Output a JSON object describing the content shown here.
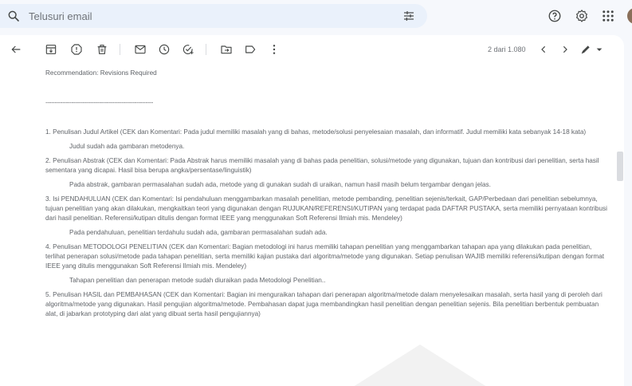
{
  "search": {
    "placeholder": "Telusuri email"
  },
  "toolbar": {
    "page_count": "2 dari 1.080"
  },
  "email": {
    "recommendation": "Recommendation: Revisions Required",
    "divider": "----------------------------------------------------------",
    "items": [
      {
        "text": "1. Penulisan Judul Artikel (CEK dan Komentari: Pada judul memiliki masalah yang di bahas, metode/solusi penyelesaian masalah, dan informatif. Judul memiliki kata sebanyak 14-18 kata)",
        "reply": "Judul sudah ada gambaran metodenya."
      },
      {
        "text": "2. Penulisan Abstrak (CEK dan Komentari: Pada Abstrak harus memiliki masalah yang di bahas pada penelitian, solusi/metode yang digunakan, tujuan dan kontribusi dari penelitian, serta hasil sementara yang dicapai. Hasil bisa berupa angka/persentase/linguistik)",
        "reply": "Pada abstrak, gambaran permasalahan sudah ada, metode yang di gunakan sudah di uraikan, namun hasil masih belum tergambar dengan jelas."
      },
      {
        "text": "3. Isi PENDAHULUAN (CEK dan Komentari: Isi pendahuluan menggambarkan masalah penelitian, metode pembanding, penelitian sejenis/terkait, GAP/Perbedaan dari penelitian sebelumnya, tujuan penelitian yang akan dilakukan, mengkaitkan teori yang digunakan dengan RUJUKAN/REFERENSI/KUTIPAN yang terdapat pada DAFTAR PUSTAKA, serta memiliki pernyataan kontribusi dari hasil penelitian. Referensi/kutipan ditulis dengan format IEEE yang menggunakan Soft Referensi Ilmiah mis. Mendeley)",
        "reply": "Pada pendahuluan, penelitian terdahulu sudah ada, gambaran permasalahan sudah ada."
      },
      {
        "text": "4. Penulisan METODOLOGI PENELITIAN (CEK dan Komentari: Bagian metodologi ini harus memiliki tahapan penelitian yang menggambarkan tahapan apa yang dilakukan pada penelitian, terlihat penerapan solusi/metode pada tahapan penelitian, serta memiliki kajian pustaka dari algoritma/metode yang digunakan. Setiap penulisan WAJIB memiliki referensi/kutipan dengan format IEEE yang ditulis menggunakan Soft Referensi Ilmiah mis. Mendeley)",
        "reply": "Tahapan penelitian dan penerapan metode sudah diuraikan pada Metodologi Penelitian.."
      },
      {
        "text": "5. Penulisan HASIL dan PEMBAHASAN (CEK dan Komentari: Bagian ini menguraikan tahapan dari penerapan algoritma/metode dalam menyelesaikan masalah, serta hasil yang di peroleh dari algoritma/metode yang digunakan. Hasil pengujian algoritma/metode. Pembahasan dapat juga membandingkan hasil penelitian dengan penelitian sejenis. Bila penelitian berbentuk pembuatan alat, di jabarkan prototyping dari alat yang dibuat serta hasil pengujiannya)"
      }
    ]
  },
  "icons": {
    "search": "search-icon",
    "tune": "tune-icon",
    "help": "help-icon",
    "settings": "gear-icon",
    "apps": "apps-icon",
    "back": "back-arrow-icon",
    "archive": "archive-icon",
    "spam": "report-spam-icon",
    "delete": "delete-icon",
    "unread": "mark-unread-icon",
    "snooze": "snooze-icon",
    "task": "add-task-icon",
    "move": "move-to-icon",
    "label": "label-icon",
    "more": "more-vert-icon",
    "prev": "chevron-left-icon",
    "next": "chevron-right-icon",
    "input_tools": "pen-icon"
  },
  "colors": {
    "background": "#f6f8fc",
    "search_bg": "#eaf1fb",
    "card": "#ffffff",
    "text": "#5f6368",
    "icon": "#444746"
  }
}
